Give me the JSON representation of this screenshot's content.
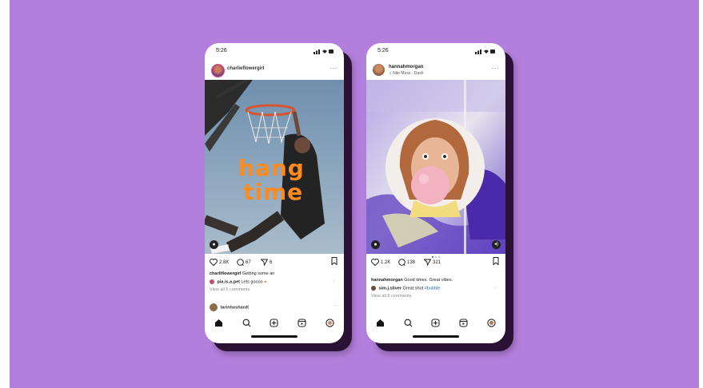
{
  "phones": [
    {
      "status_time": "5:26",
      "username": "charlieflowergirl",
      "overlay_text_line1": "hang",
      "overlay_text_line2": "time",
      "likes": "2.8K",
      "comments": "67",
      "shares": "6",
      "caption_user": "charliflowergirl",
      "caption_text": "Getting some air",
      "comment_user": "pia.is.a.pet",
      "comment_text": "Lets goooo",
      "view_all": "View all 5 comments",
      "next_post_user": "tarinhoshardt"
    },
    {
      "status_time": "5:26",
      "username": "hannahmorgan",
      "audio": "♫ Nite Moss · Dash",
      "likes": "1.2K",
      "comments": "138",
      "shares": "321",
      "caption_user": "hannahmorgan",
      "caption_text": "Good times. Great vibes.",
      "comment_user": "sim.j.sliver",
      "comment_text": "Great shot",
      "comment_tag": "#bubble",
      "view_all": "View all 8 comments"
    }
  ],
  "colors": {
    "background": "#b37fdc",
    "overlay_text": "#ff8a1e",
    "sky": "#7f99b5",
    "bubble": "#f2b2c0"
  },
  "icons": [
    "heart-icon",
    "comment-icon",
    "share-icon",
    "bookmark-icon",
    "home-icon",
    "search-icon",
    "add-icon",
    "reels-icon",
    "profile-icon",
    "more-icon"
  ]
}
